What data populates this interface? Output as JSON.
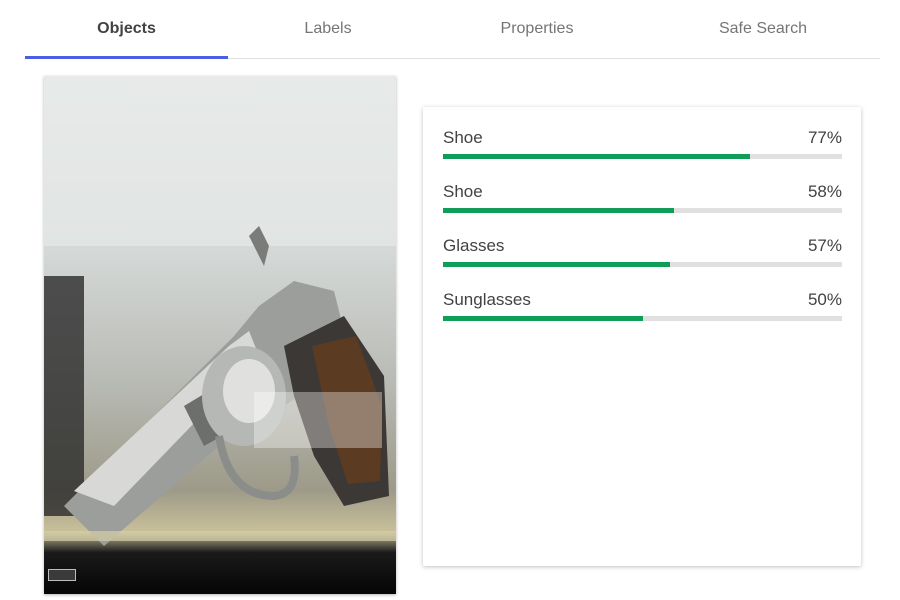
{
  "tabs": [
    {
      "label": "Objects",
      "active": true
    },
    {
      "label": "Labels",
      "active": false
    },
    {
      "label": "Properties",
      "active": false
    },
    {
      "label": "Safe Search",
      "active": false
    }
  ],
  "results": [
    {
      "label": "Shoe",
      "score_text": "77%",
      "score": 0.77
    },
    {
      "label": "Shoe",
      "score_text": "58%",
      "score": 0.58
    },
    {
      "label": "Glasses",
      "score_text": "57%",
      "score": 0.57
    },
    {
      "label": "Sunglasses",
      "score_text": "50%",
      "score": 0.5
    }
  ],
  "colors": {
    "tab_indicator": "#4a5fe3",
    "bar_fill": "#0f9d58",
    "bar_track": "#e0e0e0"
  }
}
